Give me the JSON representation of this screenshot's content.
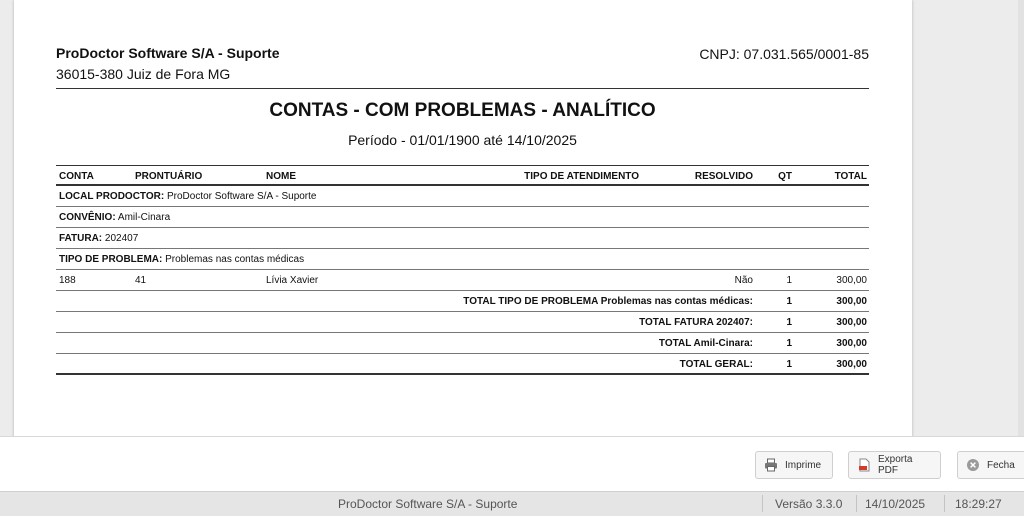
{
  "report": {
    "company": "ProDoctor Software S/A - Suporte",
    "address": "36015-380 Juiz de Fora MG",
    "cnpj": "CNPJ: 07.031.565/0001-85",
    "title": "CONTAS - COM PROBLEMAS - ANALÍTICO",
    "period": "Período - 01/01/1900 até 14/10/2025"
  },
  "table": {
    "headers": {
      "conta": "CONTA",
      "prontuario": "PRONTUÁRIO",
      "nome": "NOME",
      "tipo": "TIPO DE ATENDIMENTO",
      "resolvido": "RESOLVIDO",
      "qt": "QT",
      "total": "TOTAL"
    },
    "groups": {
      "local_label": "LOCAL PRODOCTOR:",
      "local_value": "ProDoctor Software S/A - Suporte",
      "convenio_label": "CONVÊNIO:",
      "convenio_value": "Amil-Cinara",
      "fatura_label": "FATURA:",
      "fatura_value": "202407",
      "problema_label": "TIPO DE PROBLEMA:",
      "problema_value": "Problemas nas contas médicas"
    },
    "row": {
      "conta": "188",
      "prontuario": "41",
      "nome": "Lívia Xavier",
      "tipo": "",
      "resolvido": "Não",
      "qt": "1",
      "total": "300,00"
    },
    "totals": [
      {
        "label": "TOTAL TIPO DE PROBLEMA Problemas nas contas médicas:",
        "qt": "1",
        "total": "300,00"
      },
      {
        "label": "TOTAL FATURA 202407:",
        "qt": "1",
        "total": "300,00"
      },
      {
        "label": "TOTAL Amil-Cinara:",
        "qt": "1",
        "total": "300,00"
      },
      {
        "label": "TOTAL GERAL:",
        "qt": "1",
        "total": "300,00"
      }
    ]
  },
  "toolbar": {
    "print_label": "Imprime",
    "pdf_label": "Exporta PDF",
    "close_label": "Fecha"
  },
  "statusbar": {
    "company": "ProDoctor Software S/A - Suporte",
    "version": "Versão 3.3.0",
    "date": "14/10/2025",
    "time": "18:29:27"
  },
  "icons": {
    "print": "printer-icon",
    "pdf": "pdf-icon",
    "close": "close-circle-icon"
  },
  "colors": {
    "pdf_red": "#d33b2c",
    "close_gray": "#9a9a9a"
  }
}
